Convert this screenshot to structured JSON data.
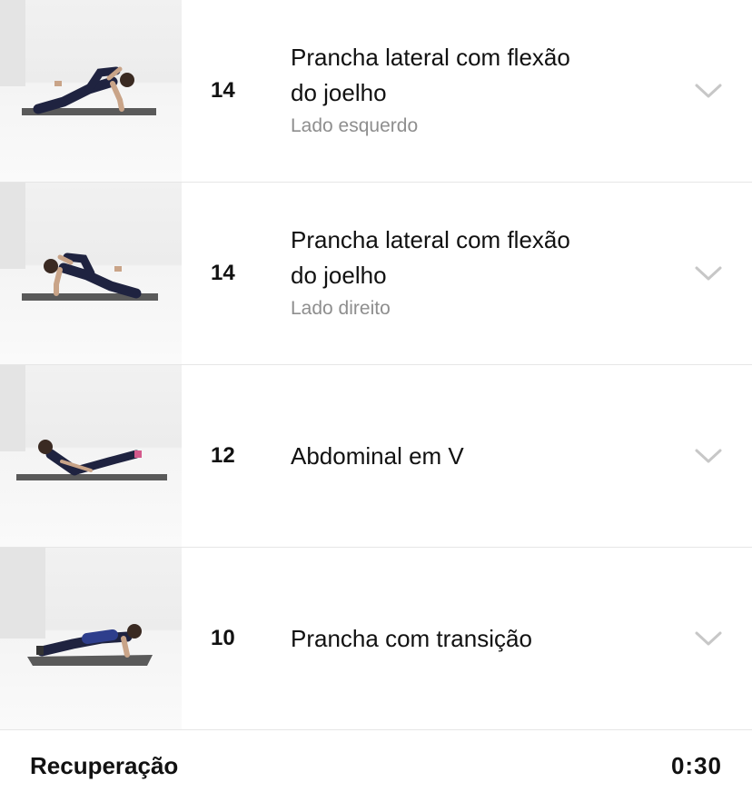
{
  "exercises": [
    {
      "reps": "14",
      "title_line1": "Prancha lateral com flexão",
      "title_line2": "do joelho",
      "subtitle": "Lado esquerdo",
      "thumbnail_icon": "side-plank-knee-left-figure"
    },
    {
      "reps": "14",
      "title_line1": "Prancha lateral com flexão",
      "title_line2": "do joelho",
      "subtitle": "Lado direito",
      "thumbnail_icon": "side-plank-knee-right-figure"
    },
    {
      "reps": "12",
      "title_line1": "Abdominal em V",
      "title_line2": "",
      "subtitle": "",
      "thumbnail_icon": "v-up-figure"
    },
    {
      "reps": "10",
      "title_line1": "Prancha com transição",
      "title_line2": "",
      "subtitle": "",
      "thumbnail_icon": "plank-transition-figure"
    }
  ],
  "footer": {
    "label": "Recuperação",
    "time": "0:30"
  },
  "colors": {
    "text": "#111111",
    "subtitle": "#8e8e8e",
    "chevron": "#c7c7c7",
    "divider": "#e6e6e6",
    "outfit": "#1f2340",
    "mat": "#5a5a5a"
  }
}
